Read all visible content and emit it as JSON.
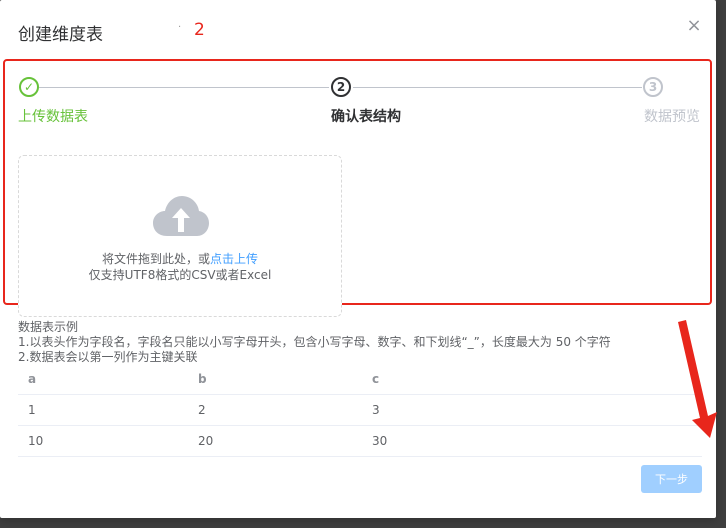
{
  "dialog": {
    "title": "创建维度表",
    "annotation_dot": "·",
    "annotation_number": "2",
    "close_symbol": "×"
  },
  "steps": [
    {
      "icon": "✓",
      "label": "上传数据表",
      "state": "finished"
    },
    {
      "icon": "2",
      "label": "确认表结构",
      "state": "active"
    },
    {
      "icon": "3",
      "label": "数据预览",
      "state": "waiting"
    }
  ],
  "upload": {
    "icon": "cloud-upload-icon",
    "text_prefix": "将文件拖到此处，或",
    "link_text": "点击上传",
    "hint": "仅支持UTF8格式的CSV或者Excel"
  },
  "example": {
    "title": "数据表示例",
    "rule_1": "1.以表头作为字段名，字段名只能以小写字母开头，包含小写字母、数字、和下划线“_”，长度最大为 50 个字符",
    "rule_2": "2.数据表会以第一列作为主键关联"
  },
  "table": {
    "headers": [
      "a",
      "b",
      "c"
    ],
    "rows": [
      [
        "1",
        "2",
        "3"
      ],
      [
        "10",
        "20",
        "30"
      ]
    ]
  },
  "footer": {
    "next_label": "下一步"
  },
  "colors": {
    "accent": "#409eff",
    "success": "#67c23a",
    "annotation_red": "#e8261c",
    "disabled_button": "#a0cfff"
  }
}
